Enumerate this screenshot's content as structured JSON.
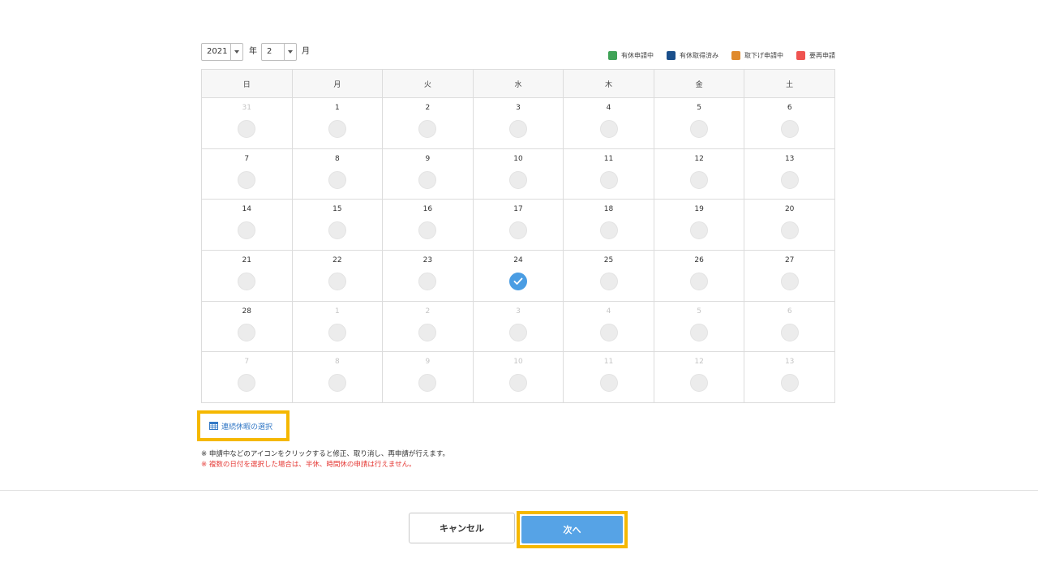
{
  "controls": {
    "year_value": "2021",
    "year_unit": "年",
    "month_value": "2",
    "month_unit": "月"
  },
  "legend": [
    {
      "label": "有休申請中",
      "color": "#3fa357"
    },
    {
      "label": "有休取得済み",
      "color": "#1a4f8b"
    },
    {
      "label": "取下げ申請中",
      "color": "#e08a2c"
    },
    {
      "label": "要再申請",
      "color": "#ef5350"
    }
  ],
  "weekdays": [
    "日",
    "月",
    "火",
    "水",
    "木",
    "金",
    "土"
  ],
  "weeks": [
    [
      {
        "day": "31",
        "out": true
      },
      {
        "day": "1"
      },
      {
        "day": "2"
      },
      {
        "day": "3"
      },
      {
        "day": "4"
      },
      {
        "day": "5"
      },
      {
        "day": "6"
      }
    ],
    [
      {
        "day": "7"
      },
      {
        "day": "8"
      },
      {
        "day": "9"
      },
      {
        "day": "10"
      },
      {
        "day": "11"
      },
      {
        "day": "12"
      },
      {
        "day": "13"
      }
    ],
    [
      {
        "day": "14"
      },
      {
        "day": "15"
      },
      {
        "day": "16"
      },
      {
        "day": "17"
      },
      {
        "day": "18"
      },
      {
        "day": "19"
      },
      {
        "day": "20"
      }
    ],
    [
      {
        "day": "21"
      },
      {
        "day": "22"
      },
      {
        "day": "23"
      },
      {
        "day": "24",
        "checked": true
      },
      {
        "day": "25"
      },
      {
        "day": "26"
      },
      {
        "day": "27"
      }
    ],
    [
      {
        "day": "28"
      },
      {
        "day": "1",
        "out": true
      },
      {
        "day": "2",
        "out": true
      },
      {
        "day": "3",
        "out": true
      },
      {
        "day": "4",
        "out": true
      },
      {
        "day": "5",
        "out": true
      },
      {
        "day": "6",
        "out": true
      }
    ],
    [
      {
        "day": "7",
        "out": true
      },
      {
        "day": "8",
        "out": true
      },
      {
        "day": "9",
        "out": true
      },
      {
        "day": "10",
        "out": true
      },
      {
        "day": "11",
        "out": true
      },
      {
        "day": "12",
        "out": true
      },
      {
        "day": "13",
        "out": true
      }
    ]
  ],
  "consecutive_link": {
    "label": "連続休暇の選択",
    "icon": "calendar-icon"
  },
  "notes": {
    "note1": "※ 申請中などのアイコンをクリックすると修正、取り消し、再申請が行えます。",
    "note2": "※ 複数の日付を選択した場合は、半休、時間休の申請は行えません。"
  },
  "buttons": {
    "cancel_label": "キャンセル",
    "next_label": "次へ"
  },
  "colors": {
    "accent": "#56a3e6",
    "highlight": "#f5b800",
    "link": "#3479c6",
    "warning_text": "#e53935"
  }
}
